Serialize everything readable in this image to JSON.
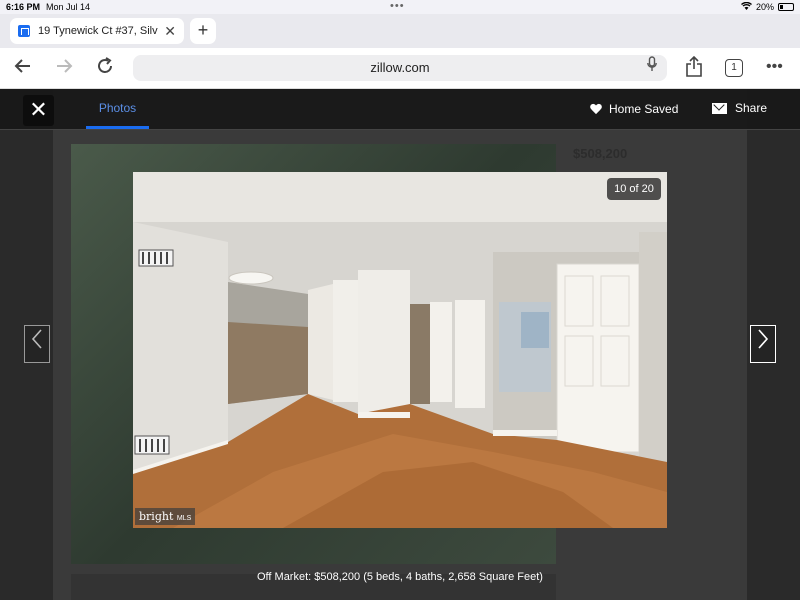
{
  "status": {
    "time": "6:16 PM",
    "date": "Mon Jul 14",
    "battery": "20%"
  },
  "browser": {
    "tab_title": "19 Tynewick Ct #37, Silv",
    "url": "zillow.com",
    "tab_count": "1"
  },
  "viewer": {
    "photos_tab": "Photos",
    "home_saved": "Home Saved",
    "share": "Share",
    "counter": "10 of 20",
    "watermark_brand": "bright",
    "watermark_mls": "MLS",
    "caption": "Off Market: $508,200 (5 beds, 4 baths, 2,658 Square Feet)",
    "bg_price": "$508,200"
  },
  "colors": {
    "accent": "#1a6cf0"
  }
}
